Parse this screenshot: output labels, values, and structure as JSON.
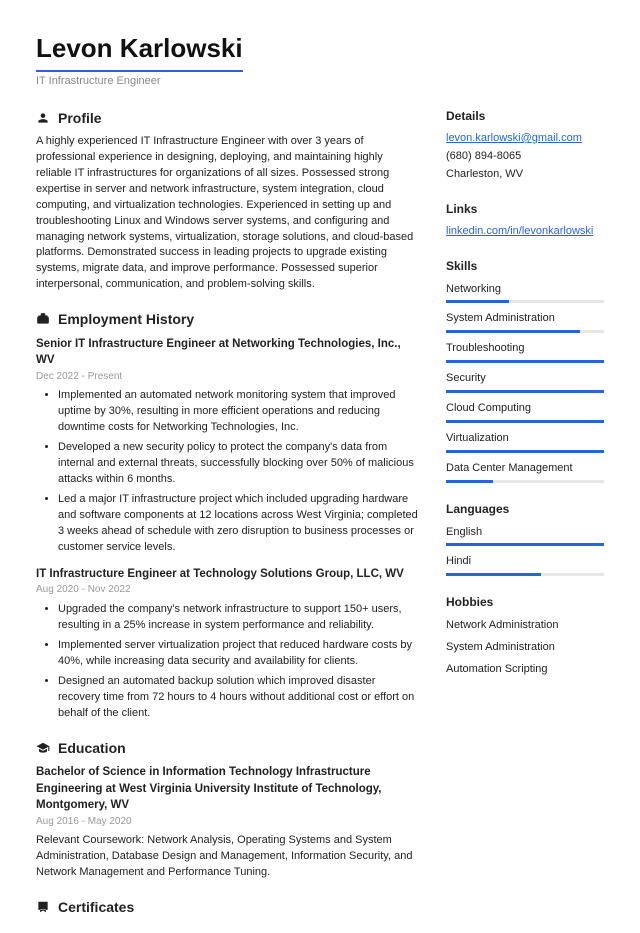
{
  "name": "Levon Karlowski",
  "title": "IT Infrastructure Engineer",
  "sections": {
    "profile": "Profile",
    "employment": "Employment History",
    "education": "Education",
    "certificates": "Certificates"
  },
  "profile": "A highly experienced IT Infrastructure Engineer with over 3 years of professional experience in designing, deploying, and maintaining highly reliable IT infrastructures for organizations of all sizes. Possessed strong expertise in server and network infrastructure, system integration, cloud computing, and virtualization technologies. Experienced in setting up and troubleshooting Linux and Windows server systems, and configuring and managing network systems, virtualization, storage solutions, and cloud-based platforms. Demonstrated success in leading projects to upgrade existing systems, migrate data, and improve performance. Possessed superior interpersonal, communication, and problem-solving skills.",
  "jobs": [
    {
      "title": "Senior IT Infrastructure Engineer at Networking Technologies, Inc., WV",
      "dates": "Dec 2022 - Present",
      "bullets": [
        "Implemented an automated network monitoring system that improved uptime by 30%, resulting in more efficient operations and reducing downtime costs for Networking Technologies, Inc.",
        "Developed a new security policy to protect the company's data from internal and external threats, successfully blocking over 50% of malicious attacks within 6 months.",
        "Led a major IT infrastructure project which included upgrading hardware and software components at 12 locations across West Virginia; completed 3 weeks ahead of schedule with zero disruption to business processes or customer service levels."
      ]
    },
    {
      "title": "IT Infrastructure Engineer at Technology Solutions Group, LLC, WV",
      "dates": "Aug 2020 - Nov 2022",
      "bullets": [
        "Upgraded the company's network infrastructure to support 150+ users, resulting in a 25% increase in system performance and reliability.",
        "Implemented server virtualization project that reduced hardware costs by 40%, while increasing data security and availability for clients.",
        "Designed an automated backup solution which improved disaster recovery time from 72 hours to 4 hours without additional cost or effort on behalf of the client."
      ]
    }
  ],
  "education": {
    "title": "Bachelor of Science in Information Technology Infrastructure Engineering at West Virginia University Institute of Technology, Montgomery, WV",
    "dates": "Aug 2016 - May 2020",
    "body": "Relevant Coursework: Network Analysis, Operating Systems and System Administration, Database Design and Management, Information Security, and Network Management and Performance Tuning."
  },
  "sidebar": {
    "details_title": "Details",
    "email": "levon.karlowski@gmail.com",
    "phone": "(680) 894-8065",
    "location": "Charleston, WV",
    "links_title": "Links",
    "linkedin": "linkedin.com/in/levonkarlowski",
    "skills_title": "Skills",
    "skills": [
      {
        "name": "Networking",
        "pct": 40
      },
      {
        "name": "System Administration",
        "pct": 85
      },
      {
        "name": "Troubleshooting",
        "pct": 100
      },
      {
        "name": "Security",
        "pct": 100
      },
      {
        "name": "Cloud Computing",
        "pct": 100
      },
      {
        "name": "Virtualization",
        "pct": 100
      },
      {
        "name": "Data Center Management",
        "pct": 30
      }
    ],
    "languages_title": "Languages",
    "languages": [
      {
        "name": "English",
        "pct": 100
      },
      {
        "name": "Hindi",
        "pct": 60
      }
    ],
    "hobbies_title": "Hobbies",
    "hobbies": [
      "Network Administration",
      "System Administration",
      "Automation Scripting"
    ]
  }
}
